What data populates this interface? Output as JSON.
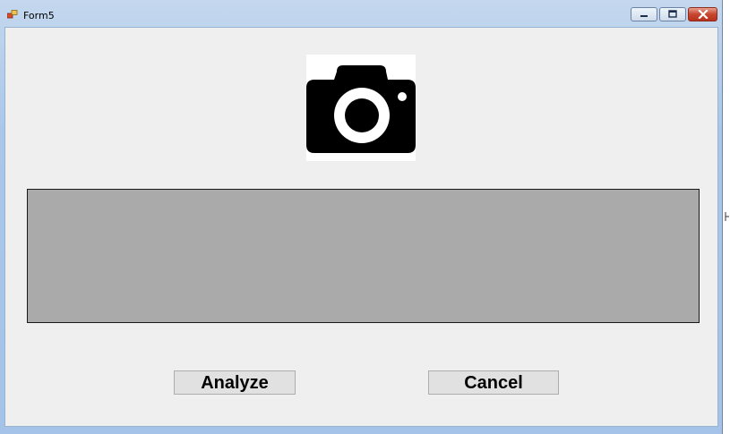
{
  "window": {
    "title": "Form5",
    "controls": {
      "minimize_icon": "minimize-icon",
      "maximize_icon": "maximize-icon",
      "close_icon": "close-icon"
    }
  },
  "form": {
    "image_icon": "camera-icon",
    "panel_color": "#aaaaaa",
    "analyze_label": "Analyze",
    "cancel_label": "Cancel"
  },
  "colors": {
    "client_background": "#efefef",
    "button_background": "#e1e1e1",
    "close_button": "#c8452e"
  }
}
